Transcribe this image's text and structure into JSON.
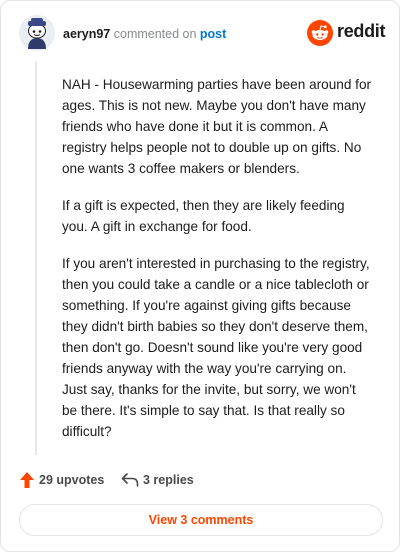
{
  "header": {
    "username": "aeryn97",
    "action_text": " commented on ",
    "post_link": "post",
    "brand_name": "reddit"
  },
  "comment": {
    "paragraphs": [
      "NAH - Housewarming parties have been around for ages. This is not new. Maybe you don't have many friends who have done it but it is common. A registry helps people not to double up on gifts. No one wants 3 coffee makers or blenders.",
      "If a gift is expected, then they are likely feeding you. A gift in exchange for food.",
      "If you aren't interested in purchasing to the registry, then you could take a candle or a nice tablecloth or something. If you're against giving gifts because they didn't birth babies so they don't deserve them, then don't go. Doesn't sound like you're very good friends anyway with the way you're carrying on. Just say, thanks for the invite, but sorry, we won't be there. It's simple to say that. Is that really so difficult?"
    ]
  },
  "footer": {
    "upvotes_label": "29 upvotes",
    "replies_label": "3 replies",
    "view_comments_label": "View 3 comments"
  },
  "colors": {
    "brand": "#ff4500",
    "link": "#0079d3",
    "text": "#1c1c1c",
    "muted": "#878a8c"
  },
  "icons": {
    "avatar": "snoo-avatar-icon",
    "brand": "reddit-logo-icon",
    "upvote": "upvote-arrow-icon",
    "reply": "reply-arrow-icon"
  }
}
